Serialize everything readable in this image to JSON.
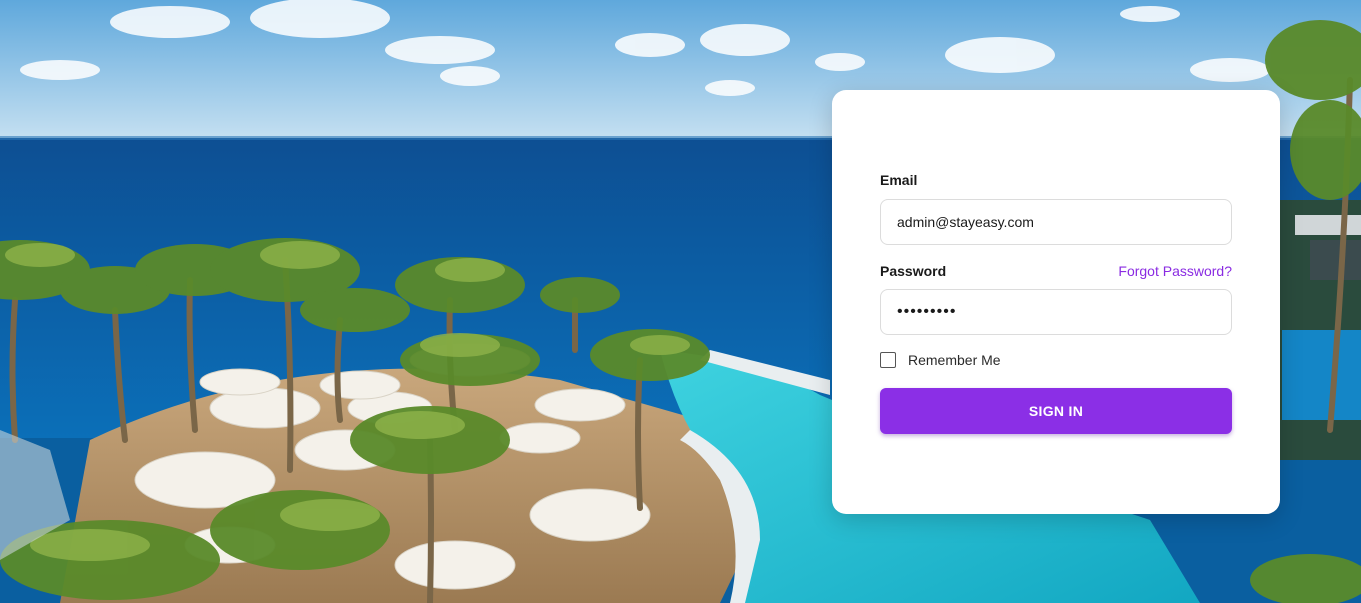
{
  "login": {
    "email_label": "Email",
    "email_value": "admin@stayeasy.com",
    "password_label": "Password",
    "password_value": "•••••••••",
    "forgot_password": "Forgot Password?",
    "remember_label": "Remember Me",
    "remember_checked": false,
    "signin_label": "SIGN IN"
  },
  "colors": {
    "accent": "#8b2fe6",
    "link": "#8a2be2",
    "card": "#ffffff"
  },
  "background": {
    "description_icon": "resort-pool-ocean-photo"
  }
}
